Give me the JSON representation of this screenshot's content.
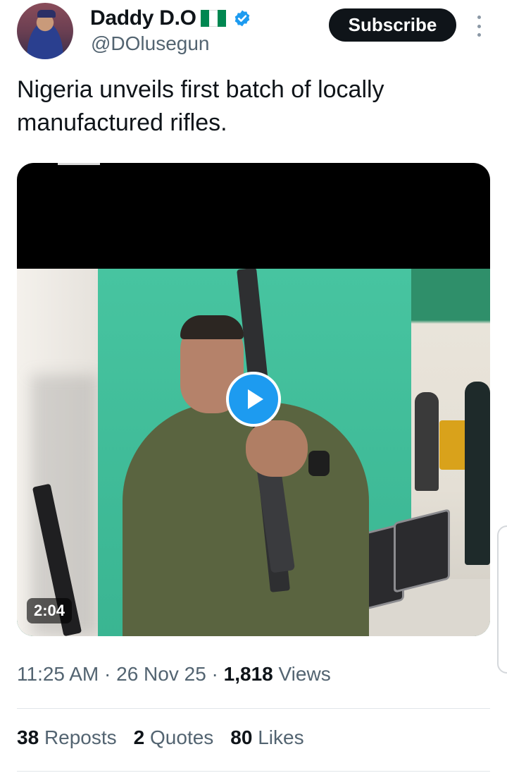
{
  "author": {
    "display_name": "Daddy D.O",
    "handle": "@DOlusegun",
    "flag_colors": [
      "#008751",
      "#ffffff",
      "#008751"
    ],
    "verified_color": "#1d9bf0"
  },
  "subscribe_label": "Subscribe",
  "post": {
    "text": "Nigeria unveils first batch of locally manufactured rifles."
  },
  "media": {
    "duration": "2:04",
    "play_icon": "play-icon"
  },
  "meta": {
    "time": "11:25 AM",
    "separator": "·",
    "date": "26 Nov 25",
    "views_count": "1,818",
    "views_label": "Views"
  },
  "stats": {
    "reposts_count": "38",
    "reposts_label": "Reposts",
    "quotes_count": "2",
    "quotes_label": "Quotes",
    "likes_count": "80",
    "likes_label": "Likes"
  },
  "colors": {
    "accent": "#1d9bf0",
    "text": "#0f1419",
    "muted": "#536471"
  }
}
